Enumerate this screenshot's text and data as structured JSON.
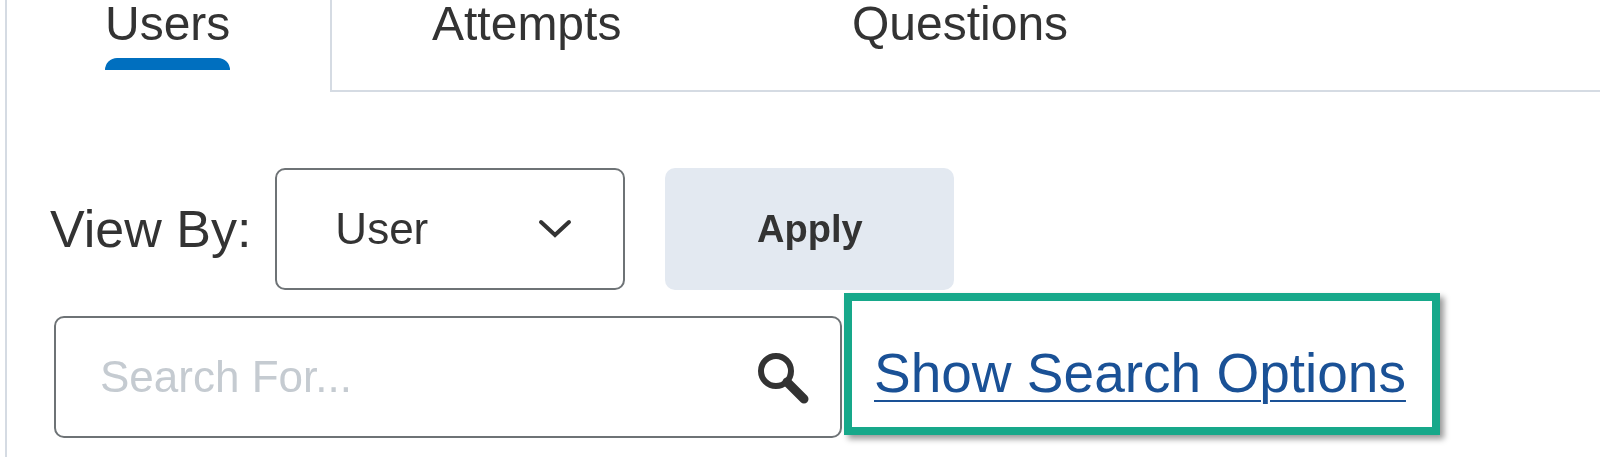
{
  "tabs": [
    {
      "label": "Users",
      "selected": true
    },
    {
      "label": "Attempts",
      "selected": false
    },
    {
      "label": "Questions",
      "selected": false
    }
  ],
  "view_by": {
    "label": "View By:",
    "value": "User"
  },
  "apply_button": "Apply",
  "search": {
    "placeholder": "Search For..."
  },
  "search_options_link": "Show Search Options"
}
